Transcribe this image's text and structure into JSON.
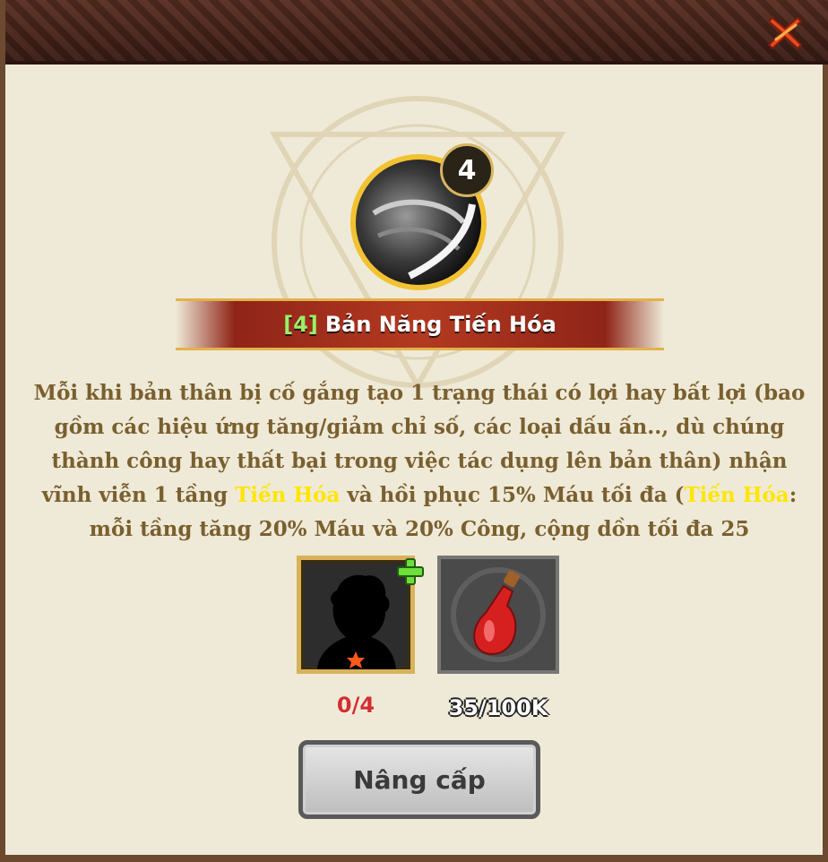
{
  "skill": {
    "level": "4",
    "title_level": "[4]",
    "title_name": "Bản Năng Tiến Hóa"
  },
  "description": {
    "part1": "Mỗi khi bản thân bị cố gắng tạo 1 trạng thái có lợi hay bất lợi (bao gồm các hiệu ứng tăng/giảm chỉ số, các loại dấu ấn.., dù chúng thành công hay thất bại trong việc tác dụng lên bản thân) nhận vĩnh viễn 1 tầng ",
    "highlight1": "Tiến Hóa",
    "part2": " và hồi phục 15% Máu tối đa (",
    "highlight2": "Tiến Hóa",
    "part3": ": mỗi tầng tăng 20% Máu và 20% Công, cộng dồn tối đa 25"
  },
  "materials": {
    "hero_count": "0/4",
    "potion_count": "35/100K"
  },
  "upgrade_button": "Nâng cấp",
  "colors": {
    "highlight": "#ffe600",
    "banner": "#b33a20",
    "level_green": "#9bf06a"
  }
}
